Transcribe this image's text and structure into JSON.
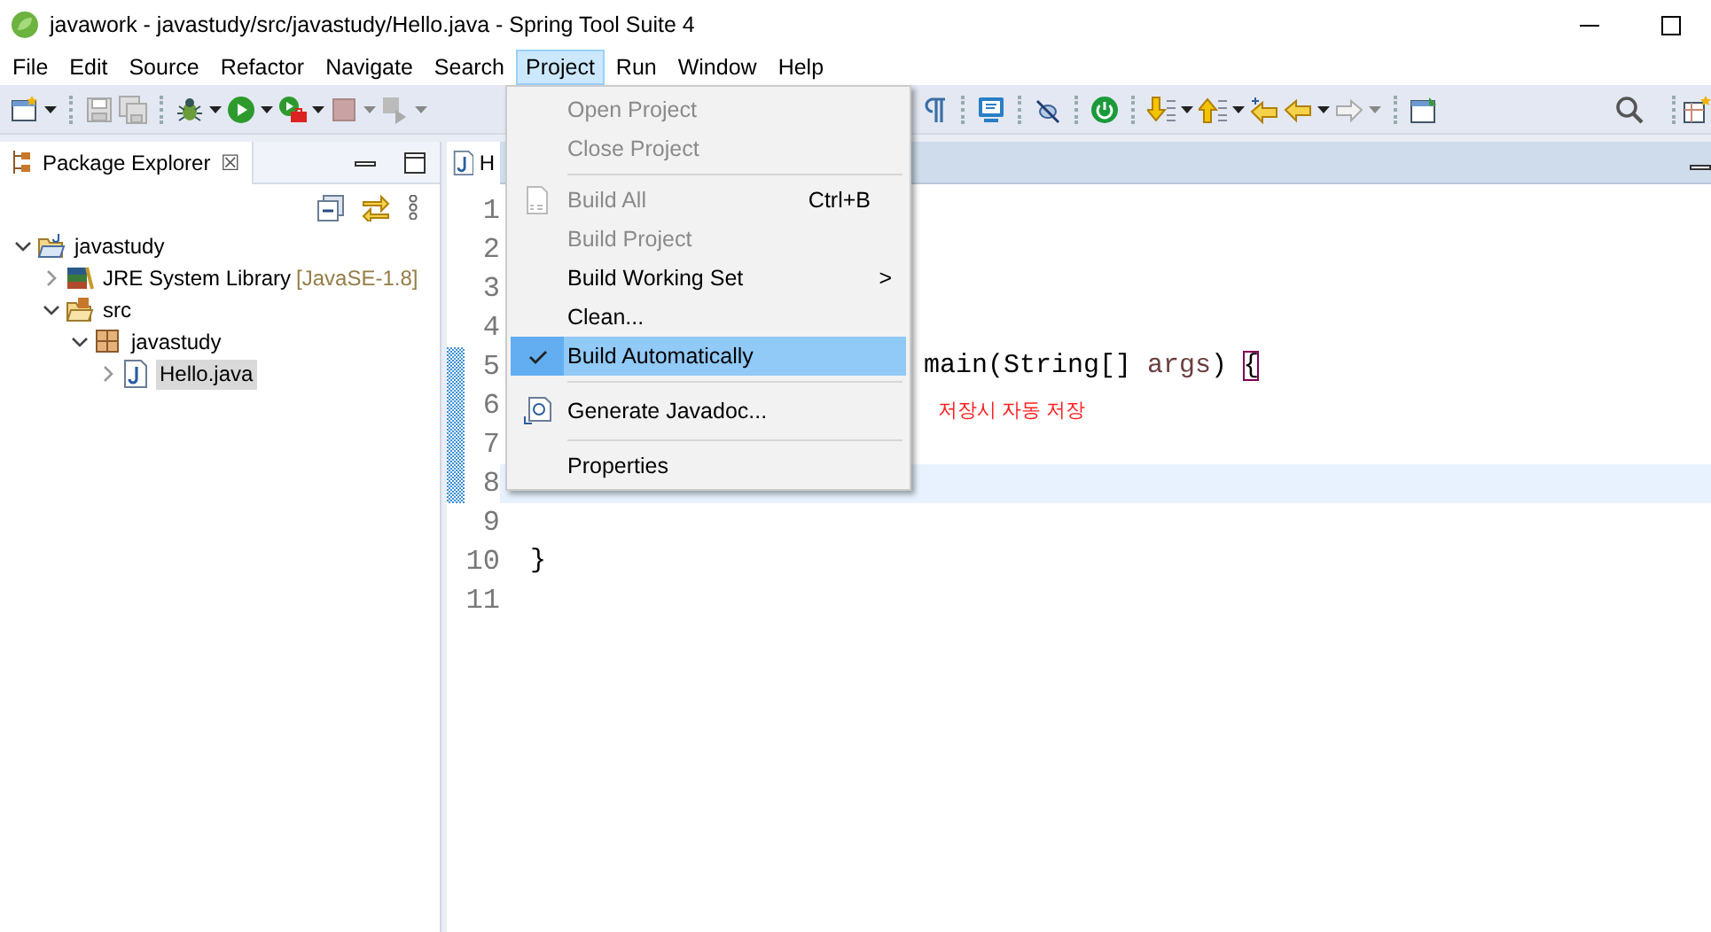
{
  "window": {
    "title": "javawork - javastudy/src/javastudy/Hello.java - Spring Tool Suite 4"
  },
  "menu_bar": [
    {
      "label": "File",
      "selected": false
    },
    {
      "label": "Edit",
      "selected": false
    },
    {
      "label": "Source",
      "selected": false
    },
    {
      "label": "Refactor",
      "selected": false
    },
    {
      "label": "Navigate",
      "selected": false
    },
    {
      "label": "Search",
      "selected": false
    },
    {
      "label": "Project",
      "selected": true
    },
    {
      "label": "Run",
      "selected": false
    },
    {
      "label": "Window",
      "selected": false
    },
    {
      "label": "Help",
      "selected": false
    }
  ],
  "project_menu": {
    "items": [
      {
        "kind": "item",
        "label": "Open Project",
        "disabled": true,
        "checked": false,
        "selected": false
      },
      {
        "kind": "item",
        "label": "Close Project",
        "disabled": true,
        "checked": false,
        "selected": false
      },
      {
        "kind": "separator"
      },
      {
        "kind": "item",
        "label": "Build All",
        "shortcut": "Ctrl+B",
        "disabled": true,
        "checked": false,
        "selected": false
      },
      {
        "kind": "item",
        "label": "Build Project",
        "disabled": true,
        "checked": false,
        "selected": false
      },
      {
        "kind": "submenu",
        "label": "Build Working Set",
        "submenu_arrow": ">",
        "disabled": false,
        "checked": false,
        "selected": false
      },
      {
        "kind": "item",
        "label": "Clean...",
        "disabled": false,
        "checked": false,
        "selected": false
      },
      {
        "kind": "item",
        "label": "Build Automatically",
        "disabled": false,
        "checked": true,
        "selected": true
      },
      {
        "kind": "separator"
      },
      {
        "kind": "item",
        "label": "Generate Javadoc...",
        "disabled": false,
        "checked": false,
        "selected": false
      },
      {
        "kind": "separator"
      },
      {
        "kind": "item",
        "label": "Properties",
        "disabled": false,
        "checked": false,
        "selected": false
      }
    ]
  },
  "package_explorer": {
    "title": "Package Explorer",
    "close": "☒",
    "tree": [
      {
        "kind": "project",
        "label": "javastudy",
        "expanded": true,
        "selected": false,
        "children": [
          {
            "kind": "library",
            "label": "JRE System Library",
            "decoration": "[JavaSE-1.8]",
            "expanded": false,
            "selected": false
          },
          {
            "kind": "source-folder",
            "label": "src",
            "expanded": true,
            "selected": false,
            "children": [
              {
                "kind": "package",
                "label": "javastudy",
                "expanded": true,
                "selected": false,
                "children": [
                  {
                    "kind": "java-file",
                    "label": "Hello.java",
                    "expanded": false,
                    "selected": true
                  }
                ]
              }
            ]
          }
        ]
      }
    ]
  },
  "editor": {
    "tab": {
      "label": "H"
    },
    "lines": [
      {
        "number": "1",
        "kind": "empty",
        "changed": false,
        "current": false
      },
      {
        "number": "2",
        "kind": "empty",
        "changed": false,
        "current": false
      },
      {
        "number": "3",
        "kind": "empty",
        "changed": false,
        "current": false
      },
      {
        "number": "4",
        "kind": "empty",
        "changed": false,
        "current": false
      },
      {
        "number": "5",
        "kind": "past-menu",
        "changed": true,
        "current": false,
        "tokens": [
          {
            "kind": "plain",
            "text": "main(String[] "
          },
          {
            "kind": "param",
            "text": "args"
          },
          {
            "kind": "plain",
            "text": ") "
          },
          {
            "kind": "bracket",
            "text": "{"
          }
        ]
      },
      {
        "number": "6",
        "kind": "note",
        "changed": true,
        "current": false,
        "text": "저장시 자동 저장"
      },
      {
        "number": "7",
        "kind": "empty",
        "changed": true,
        "current": false
      },
      {
        "number": "8",
        "kind": "empty",
        "changed": true,
        "current": true
      },
      {
        "number": "9",
        "kind": "empty",
        "changed": false,
        "current": false
      },
      {
        "number": "10",
        "kind": "code",
        "changed": false,
        "current": false,
        "tokens": [
          {
            "kind": "plain",
            "text": "}"
          }
        ]
      },
      {
        "number": "11",
        "kind": "empty",
        "changed": false,
        "current": false
      }
    ]
  }
}
